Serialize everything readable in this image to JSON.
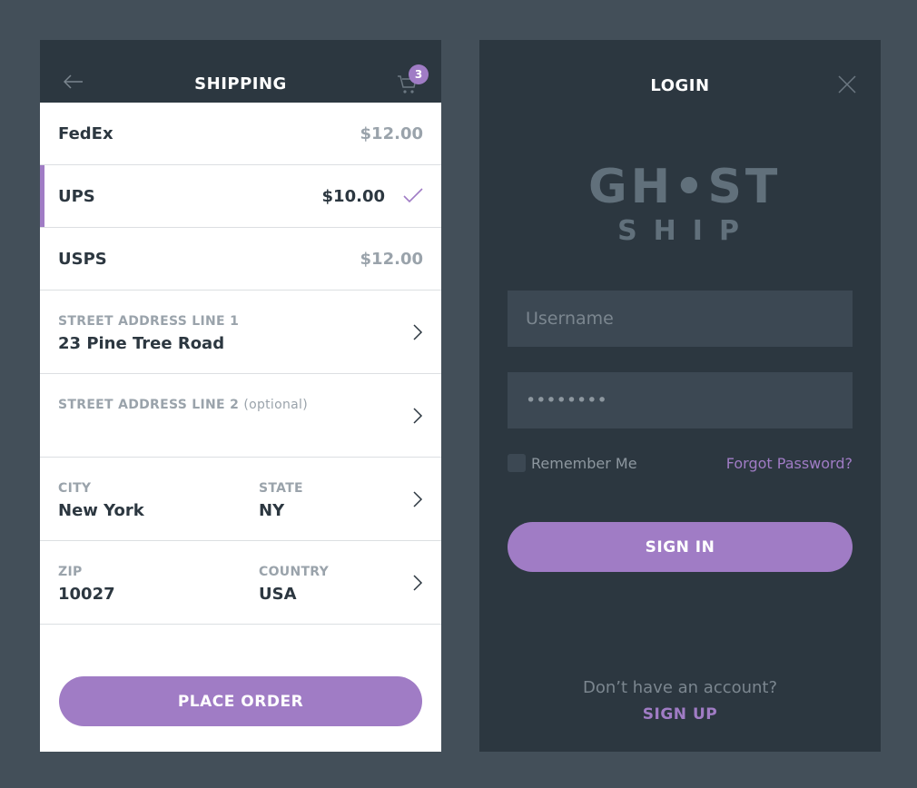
{
  "shipping": {
    "title": "SHIPPING",
    "cart_count": "3",
    "options": [
      {
        "name": "FedEx",
        "price": "$12.00",
        "selected": false
      },
      {
        "name": "UPS",
        "price": "$10.00",
        "selected": true
      },
      {
        "name": "USPS",
        "price": "$12.00",
        "selected": false
      }
    ],
    "address": {
      "line1_label": "STREET ADDRESS LINE 1",
      "line1_value": "23 Pine Tree Road",
      "line2_label": "STREET ADDRESS LINE 2",
      "line2_optional": "(optional)",
      "city_label": "CITY",
      "city_value": "New York",
      "state_label": "STATE",
      "state_value": "NY",
      "zip_label": "ZIP",
      "zip_value": "10027",
      "country_label": "COUNTRY",
      "country_value": "USA"
    },
    "place_order_label": "PLACE ORDER"
  },
  "login": {
    "title": "LOGIN",
    "logo_top": "GH•ST",
    "logo_bottom": "SHIP",
    "username_placeholder": "Username",
    "password_value": "••••••••",
    "remember_label": "Remember Me",
    "forgot_label": "Forgot Password?",
    "sign_in_label": "SIGN IN",
    "no_account_text": "Don’t have an account?",
    "sign_up_label": "SIGN UP"
  },
  "colors": {
    "accent": "#a07cc5",
    "dark_panel": "#2c3740",
    "background": "#434f59"
  },
  "icons": {
    "back": "arrow-left-icon",
    "cart": "cart-icon",
    "check": "check-icon",
    "chevron": "chevron-right-icon",
    "close": "close-icon"
  }
}
